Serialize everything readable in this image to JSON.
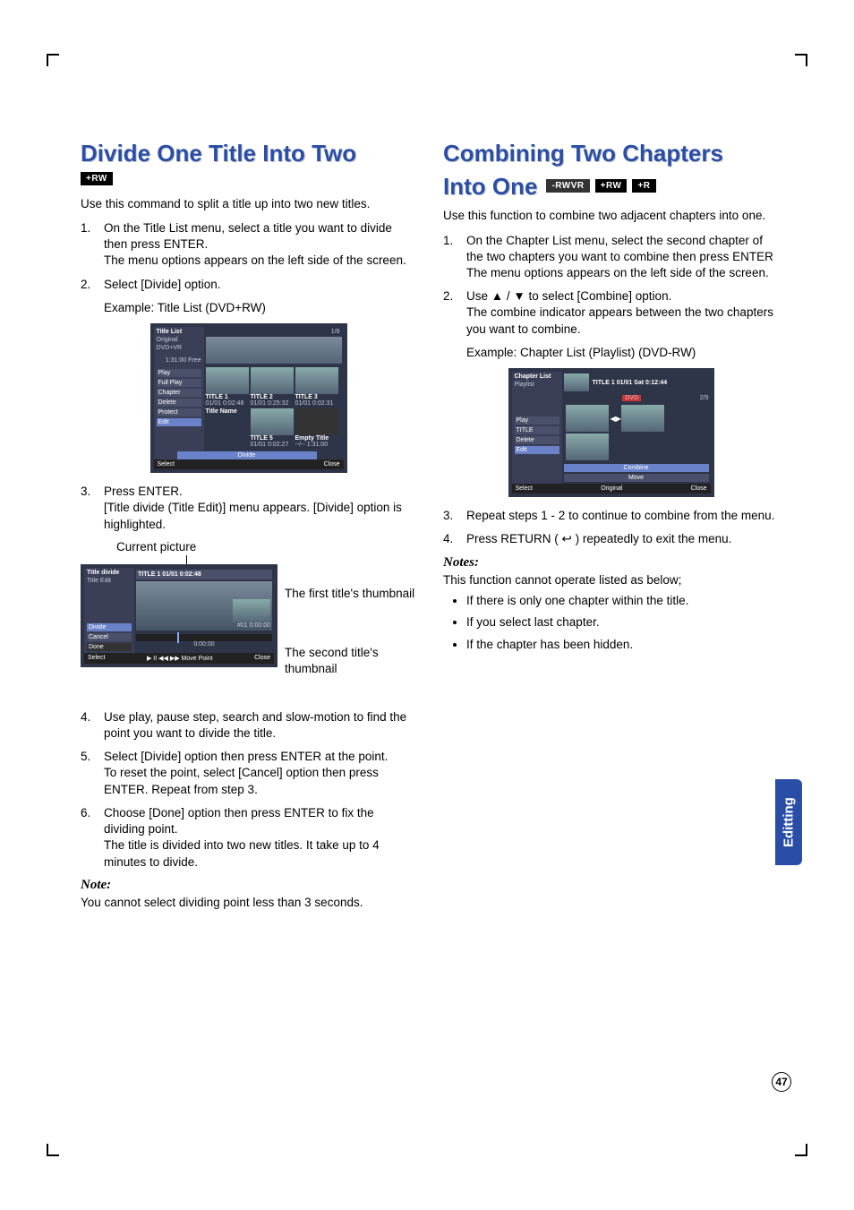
{
  "left": {
    "heading": "Divide One Title Into Two",
    "badges": [
      "+RW"
    ],
    "intro": "Use this command to split a title up into two new titles.",
    "steps": [
      {
        "text": "On the Title List menu, select a title you want to divide then press ENTER.",
        "sub": "The menu options appears on the left side of the screen."
      },
      {
        "text": "Select [Divide] option.",
        "sub": "Example: Title List (DVD+RW)"
      },
      {
        "text": "Press ENTER.",
        "sub": "[Title divide (Title Edit)] menu appears. [Divide] option is highlighted."
      },
      {
        "text": "Use play, pause step, search and slow-motion to find the point you want to divide the title."
      },
      {
        "text": "Select [Divide] option then press ENTER at the point.",
        "sub": "To reset the point, select [Cancel] option then press ENTER. Repeat from step 3."
      },
      {
        "text": "Choose [Done] option then press ENTER to fix the dividing point.",
        "sub": "The title is divided into two new titles. It take up to 4 minutes to divide."
      }
    ],
    "fig1": {
      "title": "Title List",
      "mode": "Original",
      "format": "DVD+VR",
      "capacity": "1:31:00 Free",
      "pager": "1/6",
      "menu": [
        "Play",
        "Full Play",
        "Chapter",
        "Delete",
        "Protect",
        "Edit"
      ],
      "selected": "Divide",
      "tiles": [
        {
          "name": "TITLE 1",
          "date": "01/01",
          "len": "0:02:48"
        },
        {
          "name": "TITLE 2",
          "date": "01/01",
          "len": "0:25:32"
        },
        {
          "name": "TITLE 3",
          "date": "01/01",
          "len": "0:02:31"
        },
        {
          "name": "TITLE 5",
          "date": "01/01",
          "len": "0:02:27"
        },
        {
          "name": "Title Name",
          "date": "",
          "len": ""
        },
        {
          "name": "Empty Title",
          "date": "--/--",
          "len": "1:31:00"
        }
      ],
      "bar_left": "Select",
      "bar_right": "Close"
    },
    "caption_current": "Current picture",
    "fig2": {
      "title": "Title divide",
      "subtitle": "Title Edit",
      "info": "TITLE 1  01/01  0:02:48",
      "menu": [
        "Divide",
        "Cancel",
        "Done"
      ],
      "mini": "#01  0:00:00",
      "timeline": "0:00:00",
      "bar_left": "Select",
      "bar_mid": "▶ II ◀◀ ▶▶ Move Point",
      "bar_right": "Close"
    },
    "cap_first": "The first title's thumbnail",
    "cap_second": "The second title's thumbnail",
    "note_h": "Note:",
    "note_body": "You cannot select dividing point less than 3 seconds."
  },
  "right": {
    "heading_l1": "Combining Two Chapters",
    "heading_l2": "Into One",
    "badges": [
      "-RWVR",
      "+RW",
      "+R"
    ],
    "intro": "Use this function to combine two adjacent chapters into one.",
    "steps": [
      {
        "text": "On the Chapter List menu, select the second chapter of the two chapters you want to combine then press ENTER",
        "sub": "The menu options appears on the left side of the screen."
      },
      {
        "text": "Use ▲ / ▼ to select [Combine] option.",
        "sub": "The combine indicator appears between the two chapters you want to combine.",
        "example": "Example: Chapter List (Playlist) (DVD-RW)"
      },
      {
        "text": "Repeat steps 1 - 2 to continue to combine from the menu."
      },
      {
        "text": "Press RETURN ( ↩ ) repeatedly to exit the menu."
      }
    ],
    "fig": {
      "title": "Chapter List",
      "subtitle": "Playlist",
      "info": "TITLE 1  01/01  Sat  0:12:44",
      "badge": "DVD",
      "pager": "2/5",
      "menu": [
        "Play",
        "TITLE",
        "Delete",
        "Edit"
      ],
      "selected_items": [
        "Combine",
        "Move"
      ],
      "bar_left": "Select",
      "bar_mid": "Original",
      "bar_right": "Close"
    },
    "notes_h": "Notes:",
    "notes_intro": "This function cannot operate listed as below;",
    "notes": [
      "If there is only one chapter within the title.",
      "If you select last chapter.",
      "If the chapter has been hidden."
    ]
  },
  "sidetab": "Editting",
  "pagenum": "47"
}
